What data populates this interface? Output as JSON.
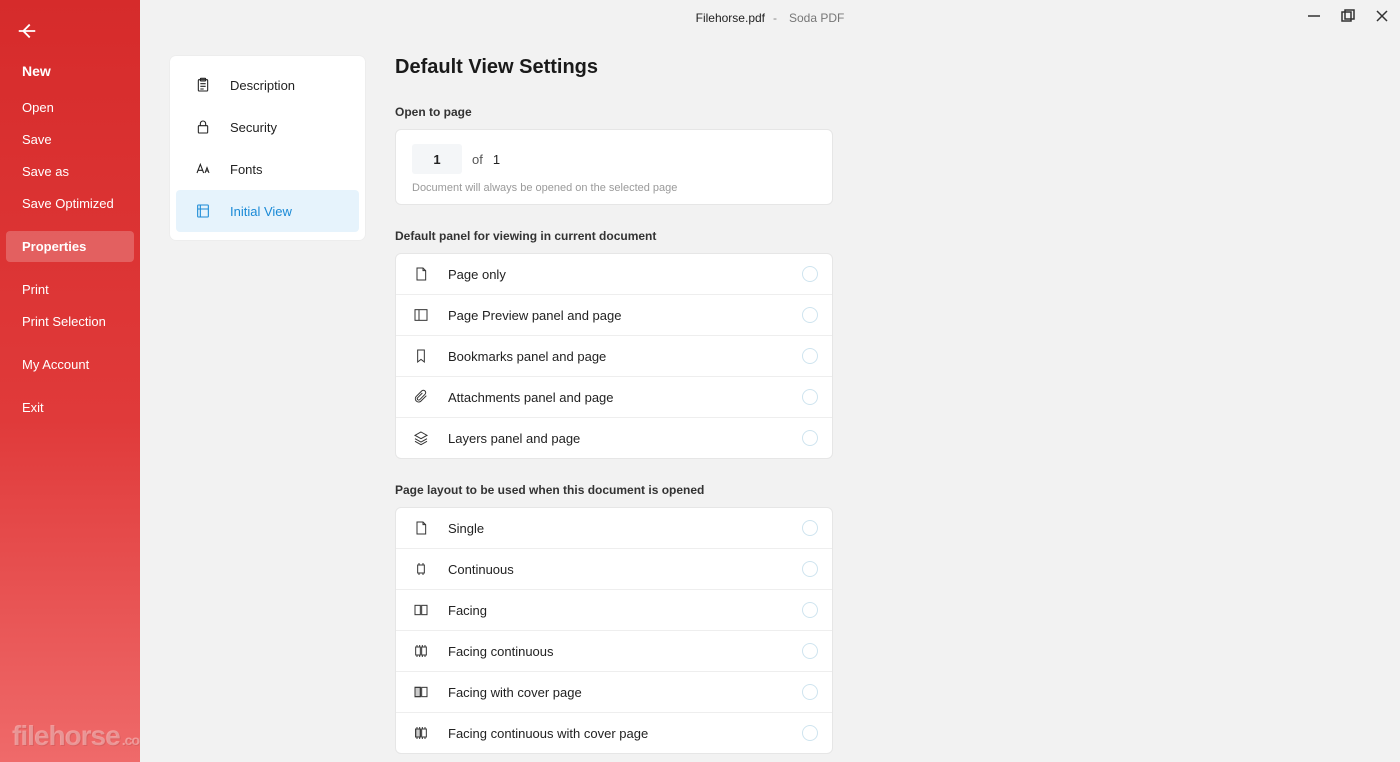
{
  "titlebar": {
    "document": "Filehorse.pdf",
    "sep": "-",
    "app": "Soda PDF"
  },
  "sidebar": {
    "items": [
      {
        "label": "New",
        "kind": "large"
      },
      {
        "label": "Open"
      },
      {
        "label": "Save"
      },
      {
        "label": "Save as"
      },
      {
        "label": "Save Optimized"
      },
      {
        "label": "Properties",
        "active": true
      },
      {
        "label": "Print"
      },
      {
        "label": "Print Selection"
      },
      {
        "label": "My Account"
      },
      {
        "label": "Exit"
      }
    ]
  },
  "watermark": {
    "brand": "filehorse",
    "suffix": ".com"
  },
  "tabs": {
    "items": [
      {
        "label": "Description"
      },
      {
        "label": "Security"
      },
      {
        "label": "Fonts"
      },
      {
        "label": "Initial View",
        "active": true
      }
    ]
  },
  "settings": {
    "heading": "Default View Settings",
    "open_to_page": {
      "label": "Open to page",
      "value": "1",
      "of_label": "of",
      "total": "1",
      "hint": "Document will always be opened on the selected page"
    },
    "default_panel": {
      "label": "Default panel for viewing in current document",
      "options": [
        "Page only",
        "Page Preview panel and page",
        "Bookmarks panel and page",
        "Attachments panel and page",
        "Layers panel and page"
      ]
    },
    "page_layout": {
      "label": "Page layout to be used when this document is opened",
      "options": [
        "Single",
        "Continuous",
        "Facing",
        "Facing continuous",
        "Facing with cover page",
        "Facing continuous with cover page"
      ]
    }
  }
}
